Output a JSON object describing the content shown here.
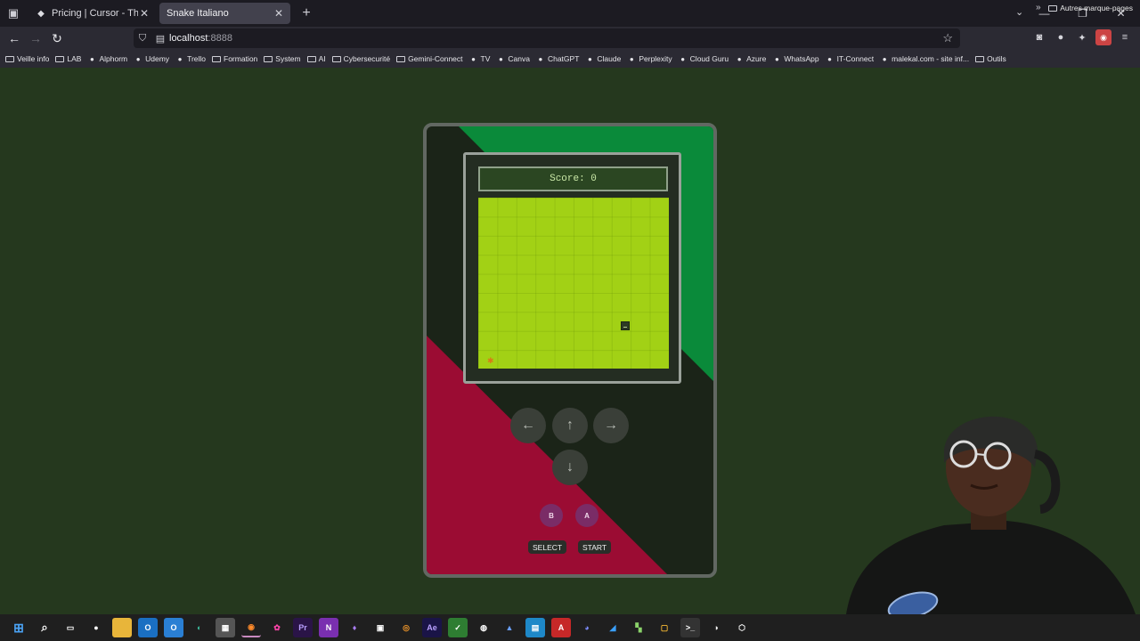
{
  "browser": {
    "tabs": [
      {
        "title": "Pricing | Cursor - The AI Code E",
        "active": false,
        "icon": "cursor-icon"
      },
      {
        "title": "Snake Italiano",
        "active": true,
        "icon": ""
      }
    ],
    "url": {
      "host": "localhost",
      "port": ":8888"
    },
    "bookmarks": [
      {
        "label": "Veille info",
        "icon": "folder-icon"
      },
      {
        "label": "LAB",
        "icon": "folder-icon"
      },
      {
        "label": "Alphorm",
        "icon": "alphorm-icon"
      },
      {
        "label": "Udemy",
        "icon": "udemy-icon"
      },
      {
        "label": "Trello",
        "icon": "trello-icon"
      },
      {
        "label": "Formation",
        "icon": "folder-icon"
      },
      {
        "label": "System",
        "icon": "folder-icon"
      },
      {
        "label": "AI",
        "icon": "folder-icon"
      },
      {
        "label": "Cybersecurité",
        "icon": "folder-icon"
      },
      {
        "label": "Gemini-Connect",
        "icon": "folder-icon"
      },
      {
        "label": "TV",
        "icon": "tv-icon"
      },
      {
        "label": "Canva",
        "icon": "canva-icon"
      },
      {
        "label": "ChatGPT",
        "icon": "chatgpt-icon"
      },
      {
        "label": "Claude",
        "icon": "claude-icon"
      },
      {
        "label": "Perplexity",
        "icon": "perplexity-icon"
      },
      {
        "label": "Cloud Guru",
        "icon": "cloud-icon"
      },
      {
        "label": "Azure",
        "icon": "azure-icon"
      },
      {
        "label": "WhatsApp",
        "icon": "whatsapp-icon"
      },
      {
        "label": "IT-Connect",
        "icon": "itconnect-icon"
      },
      {
        "label": "malekal.com - site inf...",
        "icon": "malekal-icon"
      },
      {
        "label": "Outils",
        "icon": "folder-icon"
      }
    ],
    "other_bookmarks": "Autres marque-pages"
  },
  "game": {
    "score_text": "Score: 0",
    "dpad": {
      "left": "←",
      "up": "↑",
      "right": "→",
      "down": "↓"
    },
    "buttons": {
      "b": "B",
      "a": "A",
      "select": "SELECT",
      "start": "START"
    },
    "colors": {
      "green": "#0a8a3a",
      "red": "#9b0c33",
      "board": "#a2d115"
    }
  }
}
